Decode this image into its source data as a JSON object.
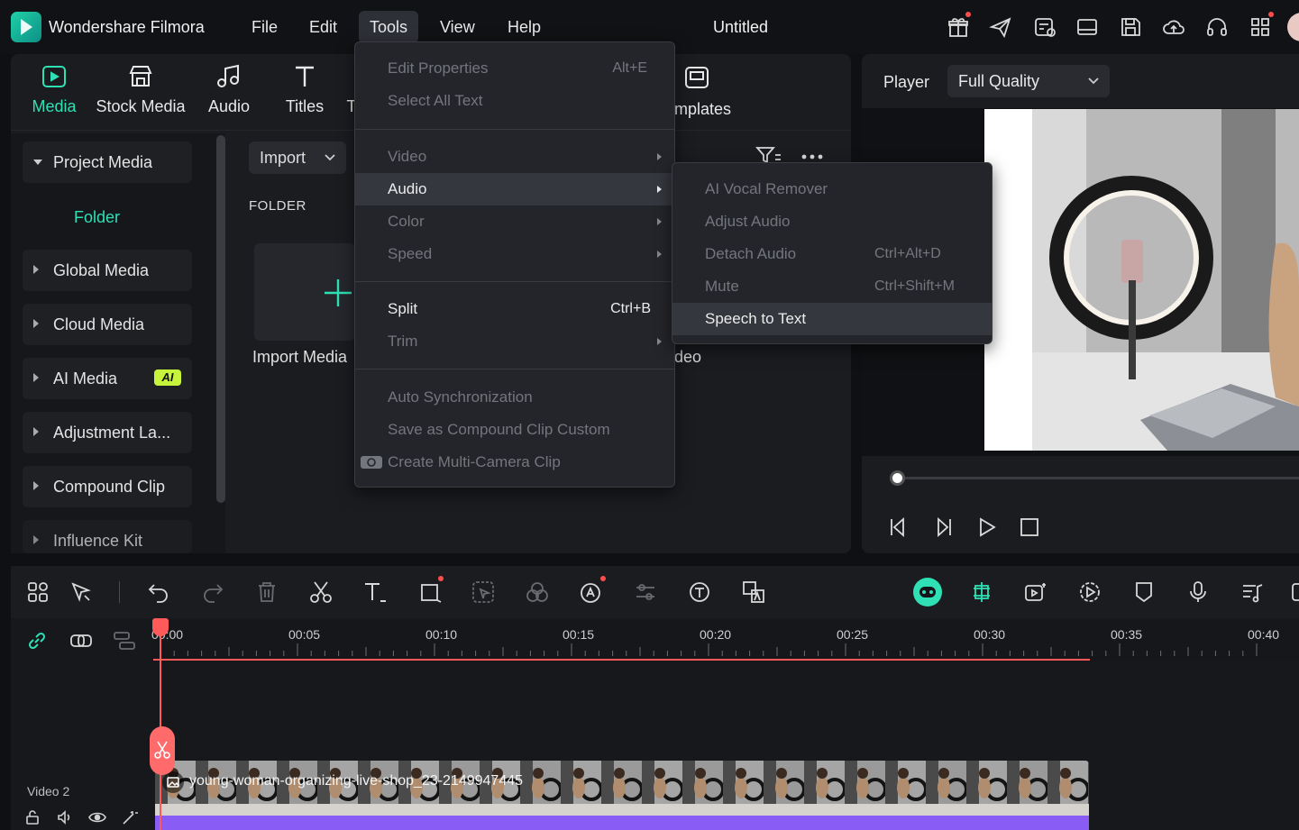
{
  "app": {
    "name": "Wondershare Filmora",
    "document_title": "Untitled"
  },
  "menubar": [
    "File",
    "Edit",
    "Tools",
    "View",
    "Help"
  ],
  "titlebar_icons": [
    "gift-icon",
    "send-icon",
    "task-icon",
    "layout-icon",
    "save-icon",
    "cloud-upload-icon",
    "headset-icon",
    "apps-grid-icon"
  ],
  "tabs": [
    {
      "label": "Media",
      "icon": "media-icon",
      "active": true
    },
    {
      "label": "Stock Media",
      "icon": "store-icon"
    },
    {
      "label": "Audio",
      "icon": "music-icon"
    },
    {
      "label": "Titles",
      "icon": "text-icon"
    },
    {
      "label": "T",
      "icon": ""
    },
    {
      "label": "mplates",
      "icon": "templates-icon"
    }
  ],
  "sidebar": {
    "project_media": "Project Media",
    "folder": "Folder",
    "items": [
      "Global Media",
      "Cloud Media",
      "AI Media",
      "Adjustment La...",
      "Compound Clip",
      "Influence Kit"
    ],
    "ai_badge": "AI"
  },
  "media": {
    "import_button": "Import",
    "folder_label": "FOLDER",
    "import_media_label": "Import Media",
    "video_label_fragment": "deo"
  },
  "player": {
    "label": "Player",
    "quality": "Full Quality",
    "progress": 0.02
  },
  "tools_menu": {
    "items": [
      {
        "label": "Edit Properties",
        "shortcut": "Alt+E",
        "enabled": false
      },
      {
        "label": "Select All Text",
        "shortcut": "",
        "enabled": false
      },
      {
        "label": "Video",
        "submenu": true,
        "enabled": false
      },
      {
        "label": "Audio",
        "submenu": true,
        "enabled": true,
        "highlighted": true
      },
      {
        "label": "Color",
        "submenu": true,
        "enabled": false
      },
      {
        "label": "Speed",
        "submenu": true,
        "enabled": false
      },
      {
        "label": "Split",
        "shortcut": "Ctrl+B",
        "enabled": true
      },
      {
        "label": "Trim",
        "submenu": true,
        "enabled": false
      },
      {
        "label": "Auto Synchronization",
        "enabled": false
      },
      {
        "label": "Save as Compound Clip Custom",
        "enabled": false
      },
      {
        "label": "Create Multi-Camera Clip",
        "enabled": false,
        "icon": "multicam-icon"
      }
    ]
  },
  "audio_submenu": {
    "items": [
      {
        "label": "AI Vocal Remover",
        "shortcut": "",
        "enabled": false
      },
      {
        "label": "Adjust Audio",
        "shortcut": "",
        "enabled": false
      },
      {
        "label": "Detach Audio",
        "shortcut": "Ctrl+Alt+D",
        "enabled": false
      },
      {
        "label": "Mute",
        "shortcut": "Ctrl+Shift+M",
        "enabled": false
      },
      {
        "label": "Speech to Text",
        "shortcut": "",
        "enabled": true,
        "highlighted": true
      }
    ]
  },
  "timeline": {
    "ticks": [
      "00:00",
      "00:05",
      "00:10",
      "00:15",
      "00:20",
      "00:25",
      "00:30",
      "00:35",
      "00:40"
    ],
    "track_label": "Video 2",
    "clip_name": "young-woman-organizing-live-shop_23-2149947445"
  },
  "colors": {
    "accent": "#2fe0b5",
    "playhead": "#ff5a5a",
    "clip_audio": "#8a5cf6"
  }
}
